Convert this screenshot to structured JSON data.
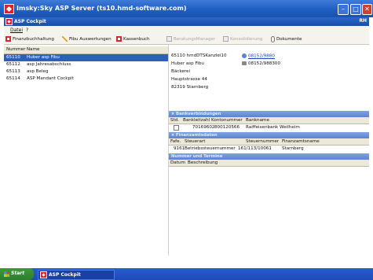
{
  "outer_window": {
    "title": "Imsky:Sky ASP Server (ts10.hmd-software.com)"
  },
  "app_window": {
    "title": "ASP Cockpit",
    "right_label": "RH"
  },
  "menu": {
    "items": [
      "Datei",
      "?"
    ]
  },
  "toolbar": [
    {
      "label": "Finanzbuchhaltung",
      "icon": "module-icon",
      "enabled": true
    },
    {
      "label": "Fibu Auswertungen",
      "icon": "pen-icon",
      "enabled": true
    },
    {
      "label": "Kassenbuch",
      "icon": "module-icon",
      "enabled": true
    },
    {
      "label": "BeratungsManager",
      "icon": "app-icon",
      "enabled": false
    },
    {
      "label": "Konsolidierung",
      "icon": "people-icon",
      "enabled": false
    },
    {
      "label": "Dokumente",
      "icon": "paperclip-icon",
      "enabled": true
    }
  ],
  "clients": {
    "headers": [
      "Nummer",
      "Name"
    ],
    "rows": [
      {
        "number": "65110",
        "name": "Huber asp Fibu",
        "selected": true
      },
      {
        "number": "65112",
        "name": "asp Jahresabschluss",
        "selected": false
      },
      {
        "number": "65113",
        "name": "asp Beleg",
        "selected": false
      },
      {
        "number": "65114",
        "name": "ASP Mandant Cockpit",
        "selected": false
      }
    ]
  },
  "detail": {
    "id_line": "65110 hmdDTSKanzlei10",
    "name": "Huber asp Fibu",
    "business": "Bäckerei",
    "street": "Hauptstrasse 44",
    "city": "82319 Starnberg",
    "phone1": "08152/9880",
    "phone2": "08152/988300"
  },
  "bank_section": {
    "title": "Bankverbindungen",
    "headers": [
      "Std.",
      "Bankleitzahl",
      "Kontonummer",
      "Bankname"
    ],
    "rows": [
      {
        "blz": "70169602",
        "konto": "800120566",
        "bank": "Raiffeisenbank Weilheim"
      }
    ]
  },
  "tax_section": {
    "title": "Finanzamtsdaten",
    "headers": [
      "Fafe.",
      "Steuerart",
      "Steuernummer",
      "Finanzamtsname"
    ],
    "rows": [
      {
        "fa": "9161",
        "art": "Betriebssteuernummer",
        "nummer": "161/113/10061",
        "amt": "Starnberg"
      }
    ]
  },
  "notes_section": {
    "title": "Nummer und Termine",
    "headers": [
      "Datum",
      "Beschreibung"
    ]
  },
  "taskbar": {
    "start_label": "Start",
    "task_label": "ASP Cockpit"
  },
  "colors": {
    "selection": "#2f5fb8",
    "titlebar": "#1f5fc4",
    "section_header": "#5a84cf",
    "taskbar": "#2a5bd1",
    "start": "#3c9a3c"
  }
}
